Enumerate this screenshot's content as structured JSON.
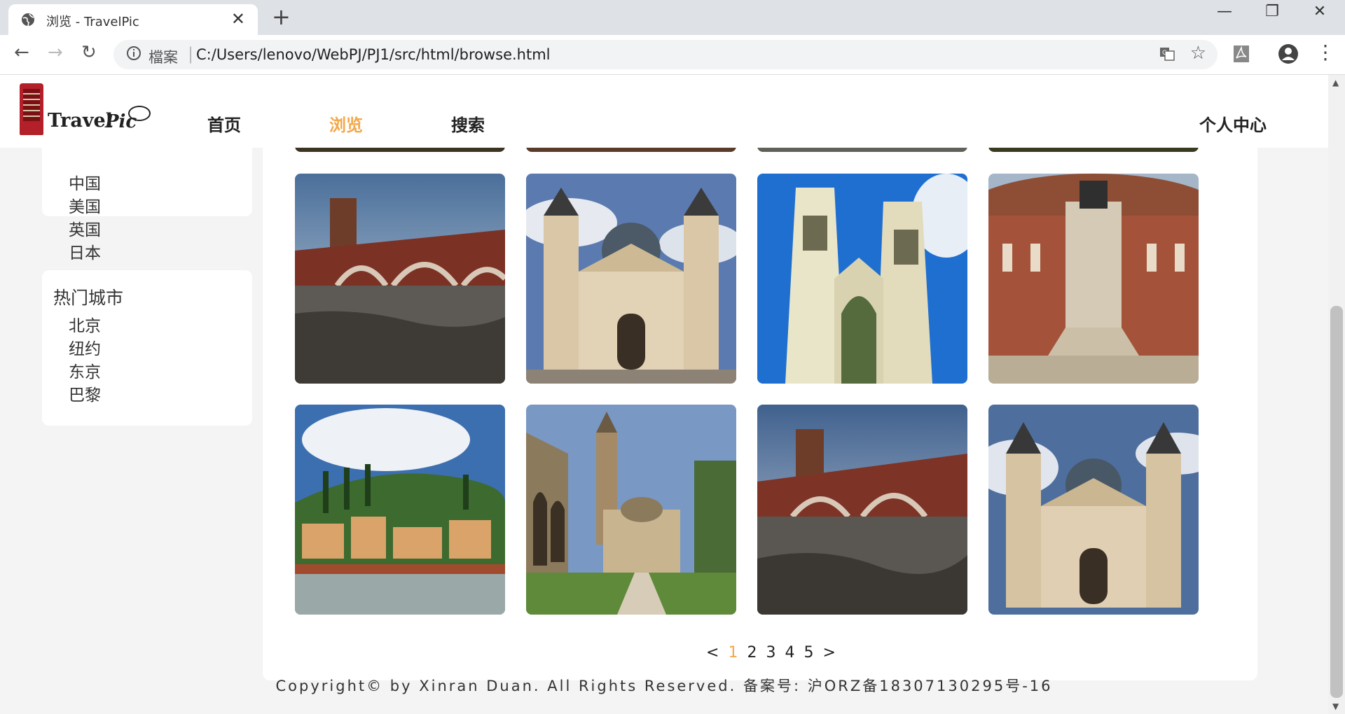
{
  "browser": {
    "tab_title": "浏览 - TravelPic",
    "security_label": "檔案",
    "url": "C:/Users/lenovo/WebPJ/PJ1/src/html/browse.html"
  },
  "site": {
    "logo_word1": "Travel",
    "logo_word2": "Pic",
    "nav": [
      "首页",
      "浏览",
      "搜索"
    ],
    "nav_active_index": 1,
    "user_center": "个人中心"
  },
  "sidebar": {
    "countries": [
      "中国",
      "美国",
      "英国",
      "日本"
    ],
    "hot_cities_title": "热门城市",
    "cities": [
      "北京",
      "纽约",
      "东京",
      "巴黎"
    ]
  },
  "gallery": {
    "photos": [
      {
        "subject": "castle-bridge"
      },
      {
        "subject": "basilica"
      },
      {
        "subject": "gothic-abbey"
      },
      {
        "subject": "royal-hall"
      },
      {
        "subject": "hillside-town"
      },
      {
        "subject": "cloister"
      },
      {
        "subject": "castle-bridge"
      },
      {
        "subject": "basilica"
      }
    ]
  },
  "pagination": {
    "prev": "<",
    "pages": [
      "1",
      "2",
      "3",
      "4",
      "5"
    ],
    "current": "1",
    "next": ">"
  },
  "footer": {
    "text": "Copyright© by Xinran Duan. All Rights Reserved. 备案号: 沪ORZ备18307130295号-16"
  },
  "colors": {
    "accent": "#f3a84a",
    "page_bg": "#f4f4f4"
  }
}
